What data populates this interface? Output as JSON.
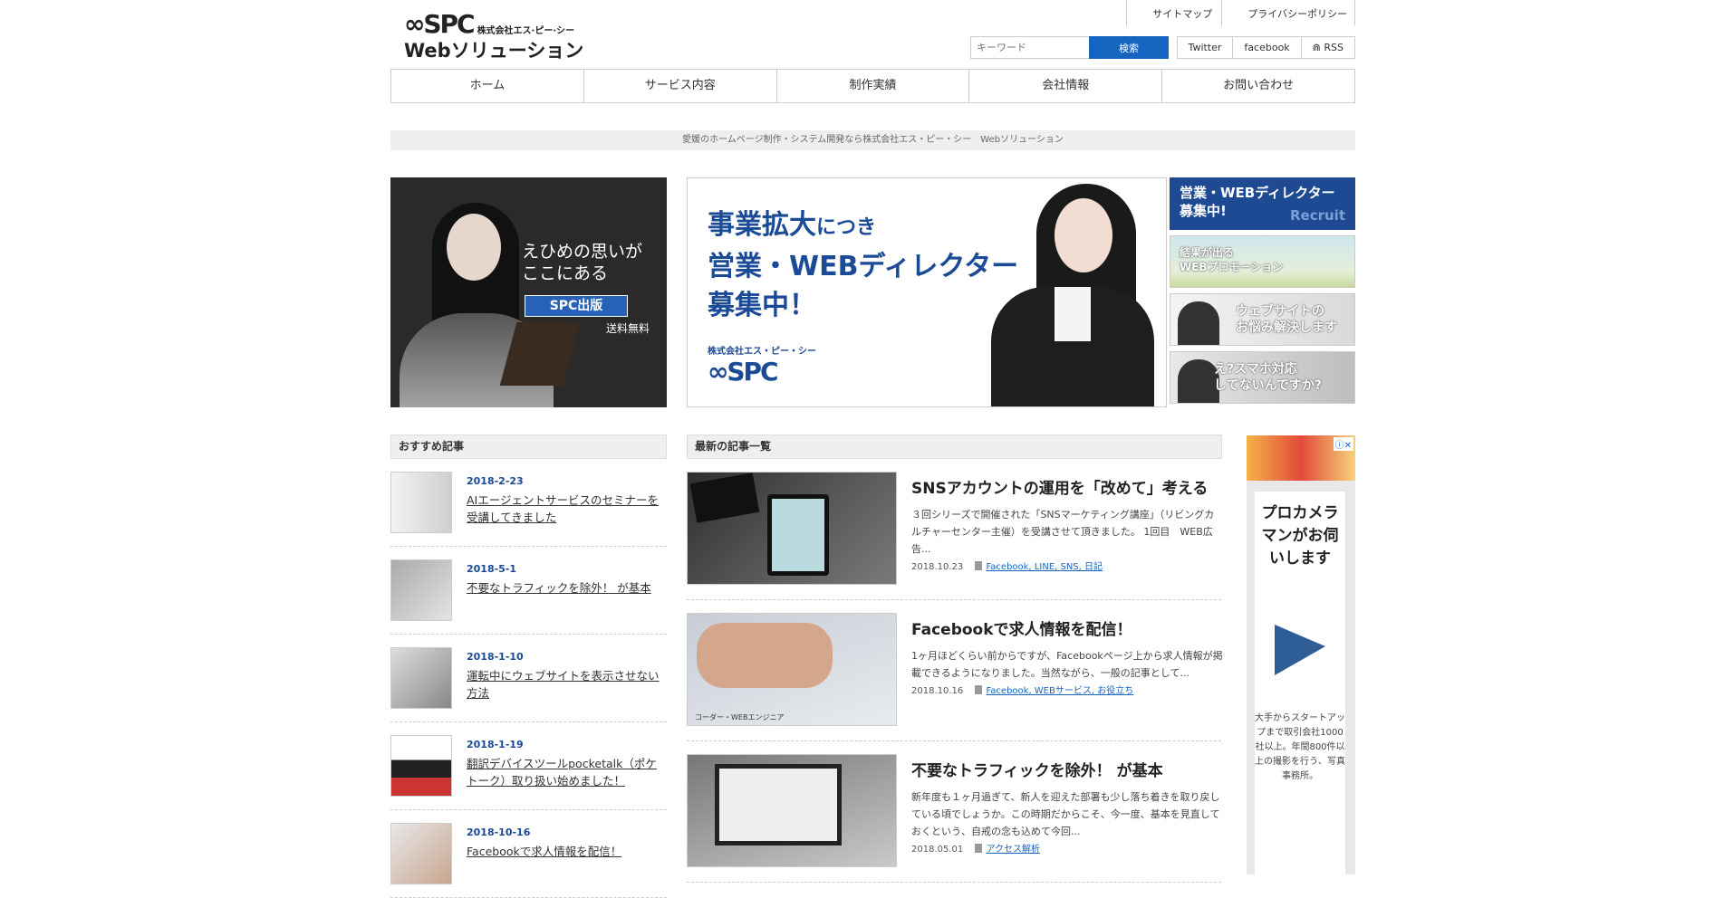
{
  "header": {
    "logo_mark": "∞SPC",
    "logo_company": "株式会社エス·ピー·シー",
    "logo_title": "Webソリューション",
    "toplinks": [
      "サイトマップ",
      "プライバシーポリシー"
    ],
    "search_placeholder": "キーワード",
    "search_button": "検索",
    "social": [
      "Twitter",
      "facebook",
      "RSS"
    ]
  },
  "nav": [
    "ホーム",
    "サービス内容",
    "制作実績",
    "会社情報",
    "お問い合わせ"
  ],
  "tagline": "愛媛のホームページ制作・システム開発なら株式会社エス・ピー・シー　Webソリューション",
  "hero_left": {
    "line1": "えひめの思いが",
    "line2": "ここにある",
    "brand": "SPC出版",
    "note": "送料無料"
  },
  "hero_main": {
    "line1a": "事業拡大",
    "line1b": "につき",
    "line2": "営業・WEBディレクター",
    "line3": "募集中！",
    "co": "株式会社エス・ピー・シー",
    "logo": "∞SPC"
  },
  "side_banners": [
    {
      "line1": "営業・WEBディレクター",
      "line2": "募集中!",
      "tag": "Recruit"
    },
    {
      "line1": "結果が出る",
      "line2": "WEBプロモーション"
    },
    {
      "line1": "ウェブサイトの",
      "line2": "お悩み解決します"
    },
    {
      "line1": "え?スマホ対応",
      "line2": "してないんですか?"
    }
  ],
  "sidebar": {
    "heading": "おすすめ記事",
    "items": [
      {
        "date": "2018-2-23",
        "title": "AIエージェントサービスのセミナーを受講してきました"
      },
      {
        "date": "2018-5-1",
        "title": "不要なトラフィックを除外！ が基本"
      },
      {
        "date": "2018-1-10",
        "title": "運転中にウェブサイトを表示させない方法"
      },
      {
        "date": "2018-1-19",
        "title": "翻訳デバイスツールpocketalk（ポケトーク）取り扱い始めました！"
      },
      {
        "date": "2018-10-16",
        "title": "Facebookで求人情報を配信！"
      }
    ]
  },
  "main": {
    "heading": "最新の記事一覧",
    "articles": [
      {
        "title": "SNSアカウントの運用を「改めて」考える",
        "excerpt": "３回シリーズで開催された「SNSマーケティング講座」（リビングカルチャーセンター主催）を受講させて頂きました。 1回目　WEB広告...",
        "date": "2018.10.23",
        "tags": "Facebook, LINE, SNS, 日記"
      },
      {
        "title": "Facebookで求人情報を配信！",
        "excerpt": "1ヶ月ほどくらい前からですが、Facebookページ上から求人情報が掲載できるようになりました。当然ながら、一般の記事として...",
        "date": "2018.10.16",
        "tags": "Facebook, WEBサービス, お役立ち",
        "caption": "コーダー・WEBエンジニア"
      },
      {
        "title": "不要なトラフィックを除外！ が基本",
        "excerpt": "新年度も１ヶ月過ぎて、新人を迎えた部署も少し落ち着きを取り戻している頃でしょうか。この時期だからこそ、今一度、基本を見直しておくという、自戒の念も込めて今回...",
        "date": "2018.05.01",
        "tags": "アクセス解析"
      }
    ]
  },
  "ad": {
    "headline": "プロカメラマンがお伺いします",
    "body": "大手からスタートアップまで取引会社1000社以上。年間800件以上の撮影を行う、写真事務所。"
  }
}
